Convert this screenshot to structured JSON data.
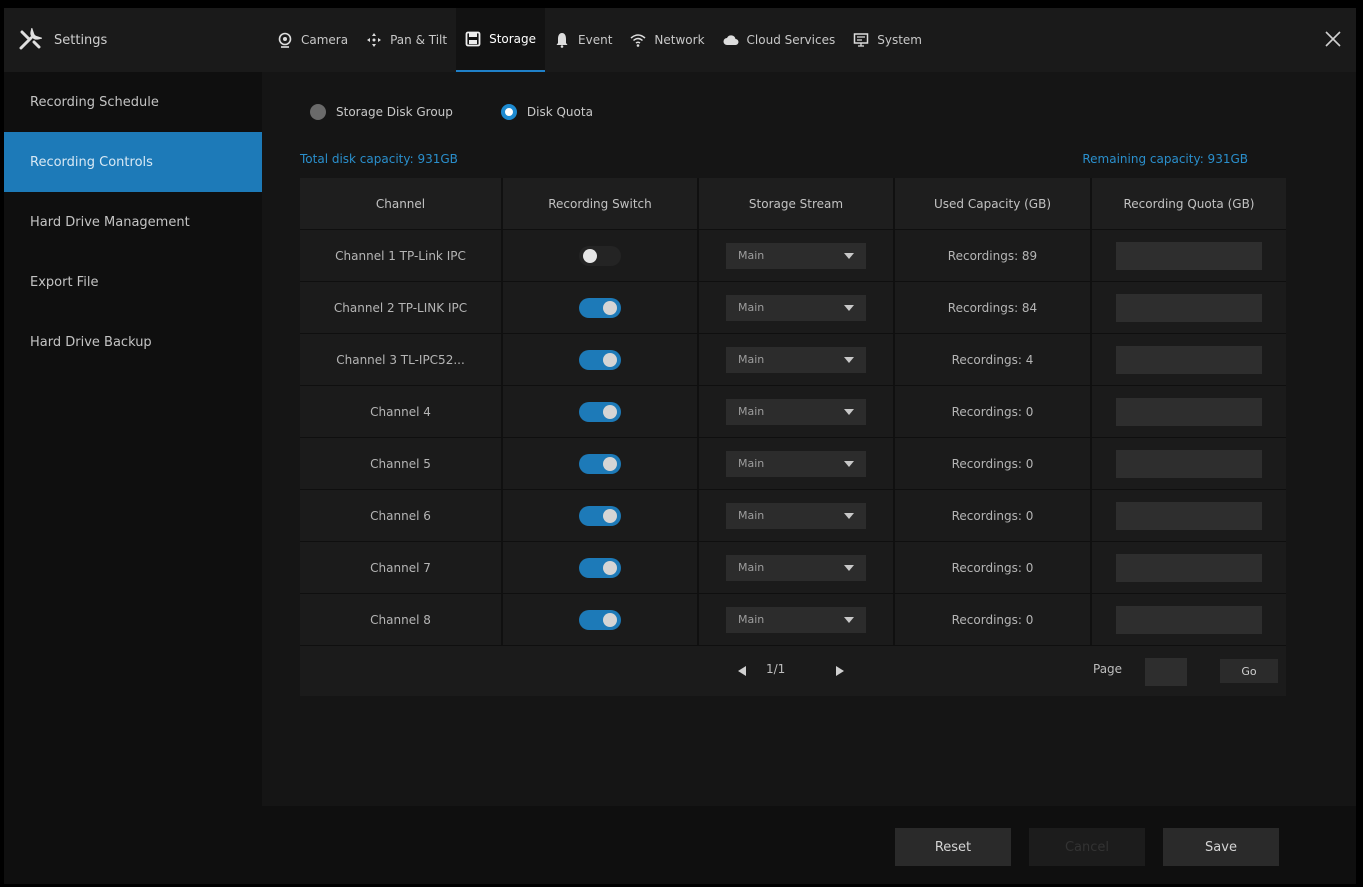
{
  "header": {
    "settings_label": "Settings",
    "tabs": [
      {
        "label": "Camera",
        "icon": "camera-icon"
      },
      {
        "label": "Pan & Tilt",
        "icon": "pan-tilt-icon"
      },
      {
        "label": "Storage",
        "icon": "storage-icon",
        "active": true
      },
      {
        "label": "Event",
        "icon": "event-icon"
      },
      {
        "label": "Network",
        "icon": "network-icon"
      },
      {
        "label": "Cloud Services",
        "icon": "cloud-icon"
      },
      {
        "label": "System",
        "icon": "system-icon"
      }
    ]
  },
  "sidebar": {
    "items": [
      {
        "label": "Recording Schedule"
      },
      {
        "label": "Recording Controls",
        "active": true
      },
      {
        "label": "Hard Drive Management"
      },
      {
        "label": "Export File"
      },
      {
        "label": "Hard Drive Backup"
      }
    ]
  },
  "mode": {
    "options": [
      "Storage Disk Group",
      "Disk Quota"
    ],
    "selected": "Disk Quota"
  },
  "capacity": {
    "total": "Total disk capacity: 931GB",
    "remaining": "Remaining capacity: 931GB"
  },
  "table": {
    "headers": [
      "Channel",
      "Recording Switch",
      "Storage Stream",
      "Used Capacity (GB)",
      "Recording Quota (GB)"
    ],
    "rows": [
      {
        "channel": "Channel 1 TP-Link IPC",
        "switch": "off",
        "stream": "Main",
        "used": "Recordings: 89"
      },
      {
        "channel": "Channel 2 TP-LINK IPC",
        "switch": "on",
        "stream": "Main",
        "used": "Recordings: 84"
      },
      {
        "channel": "Channel 3 TL-IPC52...",
        "switch": "on",
        "stream": "Main",
        "used": "Recordings: 4"
      },
      {
        "channel": "Channel 4",
        "switch": "on",
        "stream": "Main",
        "used": "Recordings: 0"
      },
      {
        "channel": "Channel 5",
        "switch": "on",
        "stream": "Main",
        "used": "Recordings: 0"
      },
      {
        "channel": "Channel 6",
        "switch": "on",
        "stream": "Main",
        "used": "Recordings: 0"
      },
      {
        "channel": "Channel 7",
        "switch": "on",
        "stream": "Main",
        "used": "Recordings: 0"
      },
      {
        "channel": "Channel 8",
        "switch": "on",
        "stream": "Main",
        "used": "Recordings: 0"
      }
    ]
  },
  "pagination": {
    "current": "1/1",
    "page_label": "Page",
    "go_label": "Go"
  },
  "footer": {
    "reset_label": "Reset",
    "cancel_label": "Cancel",
    "save_label": "Save"
  },
  "colors": {
    "accent": "#1d7ab8",
    "capacity_text": "#2a8fcc"
  }
}
